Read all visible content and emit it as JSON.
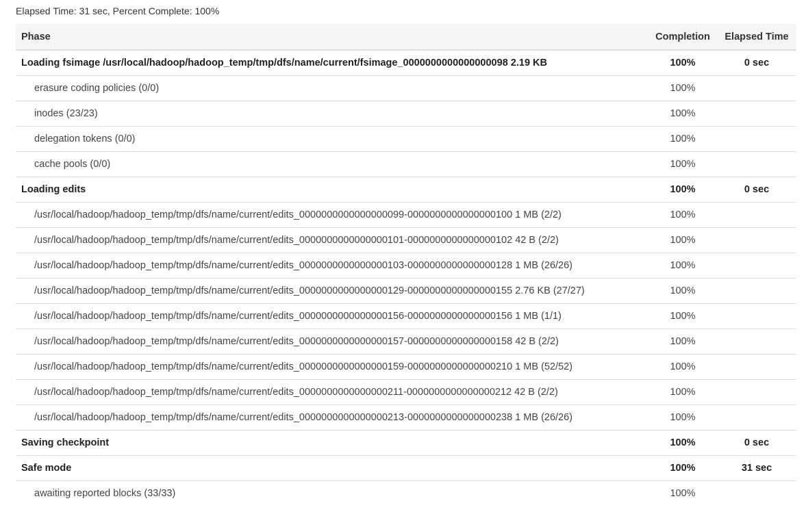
{
  "summary": {
    "text": "Elapsed Time: 31 sec, Percent Complete: 100%"
  },
  "table": {
    "headers": {
      "phase": "Phase",
      "completion": "Completion",
      "elapsed": "Elapsed Time"
    },
    "rows": [
      {
        "kind": "phase",
        "name": "Loading fsimage /usr/local/hadoop/hadoop_temp/tmp/dfs/name/current/fsimage_0000000000000000098 2.19 KB",
        "completion": "100%",
        "elapsed": "0 sec"
      },
      {
        "kind": "step",
        "name": "erasure coding policies (0/0)",
        "completion": "100%",
        "elapsed": ""
      },
      {
        "kind": "step",
        "name": "inodes (23/23)",
        "completion": "100%",
        "elapsed": ""
      },
      {
        "kind": "step",
        "name": "delegation tokens (0/0)",
        "completion": "100%",
        "elapsed": ""
      },
      {
        "kind": "step",
        "name": "cache pools (0/0)",
        "completion": "100%",
        "elapsed": ""
      },
      {
        "kind": "phase",
        "name": "Loading edits",
        "completion": "100%",
        "elapsed": "0 sec"
      },
      {
        "kind": "step",
        "name": "/usr/local/hadoop/hadoop_temp/tmp/dfs/name/current/edits_0000000000000000099-0000000000000000100 1 MB (2/2)",
        "completion": "100%",
        "elapsed": ""
      },
      {
        "kind": "step",
        "name": "/usr/local/hadoop/hadoop_temp/tmp/dfs/name/current/edits_0000000000000000101-0000000000000000102 42 B (2/2)",
        "completion": "100%",
        "elapsed": ""
      },
      {
        "kind": "step",
        "name": "/usr/local/hadoop/hadoop_temp/tmp/dfs/name/current/edits_0000000000000000103-0000000000000000128 1 MB (26/26)",
        "completion": "100%",
        "elapsed": ""
      },
      {
        "kind": "step",
        "name": "/usr/local/hadoop/hadoop_temp/tmp/dfs/name/current/edits_0000000000000000129-0000000000000000155 2.76 KB (27/27)",
        "completion": "100%",
        "elapsed": ""
      },
      {
        "kind": "step",
        "name": "/usr/local/hadoop/hadoop_temp/tmp/dfs/name/current/edits_0000000000000000156-0000000000000000156 1 MB (1/1)",
        "completion": "100%",
        "elapsed": ""
      },
      {
        "kind": "step",
        "name": "/usr/local/hadoop/hadoop_temp/tmp/dfs/name/current/edits_0000000000000000157-0000000000000000158 42 B (2/2)",
        "completion": "100%",
        "elapsed": ""
      },
      {
        "kind": "step",
        "name": "/usr/local/hadoop/hadoop_temp/tmp/dfs/name/current/edits_0000000000000000159-0000000000000000210 1 MB (52/52)",
        "completion": "100%",
        "elapsed": ""
      },
      {
        "kind": "step",
        "name": "/usr/local/hadoop/hadoop_temp/tmp/dfs/name/current/edits_0000000000000000211-0000000000000000212 42 B (2/2)",
        "completion": "100%",
        "elapsed": ""
      },
      {
        "kind": "step",
        "name": "/usr/local/hadoop/hadoop_temp/tmp/dfs/name/current/edits_0000000000000000213-0000000000000000238 1 MB (26/26)",
        "completion": "100%",
        "elapsed": ""
      },
      {
        "kind": "phase",
        "name": "Saving checkpoint",
        "completion": "100%",
        "elapsed": "0 sec"
      },
      {
        "kind": "phase",
        "name": "Safe mode",
        "completion": "100%",
        "elapsed": "31 sec"
      },
      {
        "kind": "step",
        "name": "awaiting reported blocks (33/33)",
        "completion": "100%",
        "elapsed": ""
      }
    ]
  }
}
